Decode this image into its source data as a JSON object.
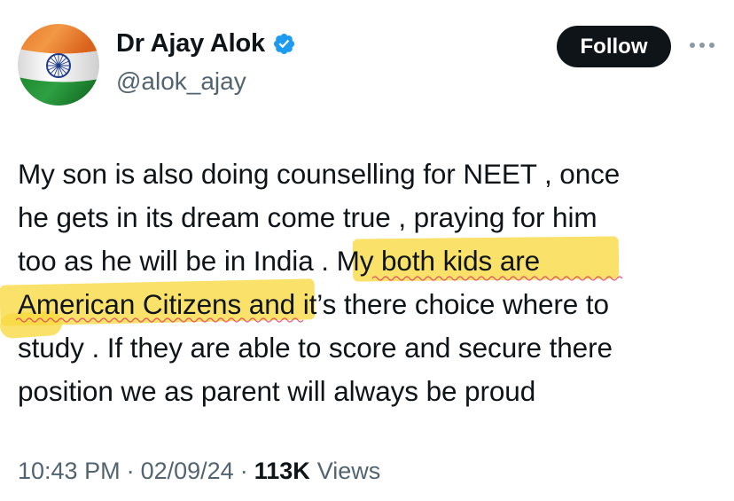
{
  "author": {
    "display_name": "Dr Ajay Alok",
    "handle": "@alok_ajay",
    "avatar_icon": "india-flag-avatar",
    "verified_icon": "verified-badge-icon",
    "verified_color": "#1d9bf0"
  },
  "actions": {
    "follow_label": "Follow",
    "more_icon": "more-options-icon"
  },
  "tweet": {
    "lines": [
      "My son is also doing counselling for NEET , once",
      "he gets in its dream come true , praying for him",
      "too as he will be in India . My both kids are",
      "American Citizens and it’s there choice where to",
      "study . If they are able to score and secure there",
      "position we as parent will always be proud"
    ],
    "highlight_color": "#f8d940"
  },
  "meta": {
    "time": "10:43 PM",
    "separator": "·",
    "date": "02/09/24",
    "views_count": "113K",
    "views_label": "Views"
  },
  "colors": {
    "primary_text": "#0f1419",
    "secondary_text": "#536471",
    "follow_bg": "#0f1419",
    "follow_text": "#ffffff"
  }
}
